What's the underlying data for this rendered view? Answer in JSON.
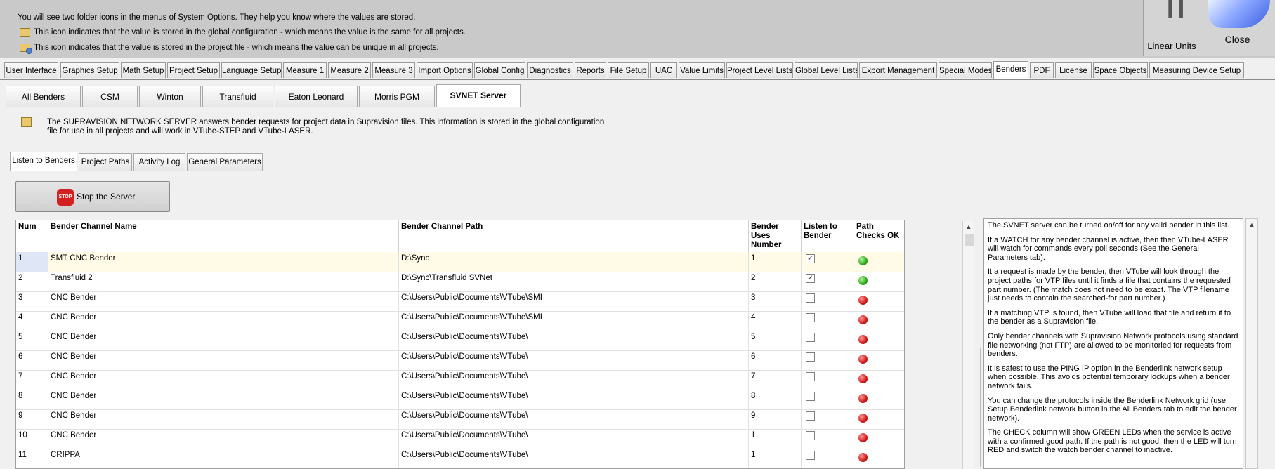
{
  "info": {
    "line1": "You will see two folder icons in the menus of System Options.  They help you know where the values are stored.",
    "line2": "This icon indicates that the value is stored in the global configuration - which means the value is the same for all projects.",
    "line3": "This icon indicates that the value is stored in the project file - which means the value can be unique in all projects."
  },
  "units": {
    "label": "Linear Units",
    "glyph": "┃┃"
  },
  "close": {
    "label": "Close"
  },
  "main_tabs": [
    "User Interface",
    "Graphics Setup",
    "Math Setup",
    "Project Setup",
    "Language Setup",
    "Measure 1",
    "Measure 2",
    "Measure 3",
    "Import Options",
    "Global Config",
    "Diagnostics",
    "Reports",
    "File Setup",
    "UAC",
    "Value Limits",
    "Project Level Lists",
    "Global Level Lists",
    "Export Management",
    "Special Modes",
    "Benders",
    "PDF",
    "License",
    "Space Objects",
    "Measuring Device Setup"
  ],
  "bender_tabs": [
    "All Benders",
    "CSM",
    "Winton",
    "Transfluid",
    "Eaton Leonard",
    "Morris PGM",
    "SVNET Server"
  ],
  "description": "The SUPRAVISION NETWORK SERVER answers bender requests for project data in Supravision files.  This information is stored in the global configuration file for use in all projects and will work in VTube-STEP and VTube-LASER.",
  "sub_tabs": [
    "Listen to Benders",
    "Project Paths",
    "Activity Log",
    "General Parameters"
  ],
  "stop_button": {
    "label": "Stop the Server",
    "icon_text": "STOP"
  },
  "grid": {
    "headers": [
      "Num",
      "Bender Channel Name",
      "Bender Channel Path",
      "Bender Uses Number",
      "Listen to Bender",
      "Path Checks OK"
    ],
    "rows": [
      {
        "num": "1",
        "name": "SMT CNC Bender",
        "path": "D:\\Sync",
        "uses": "1",
        "listen": true,
        "ok": "green"
      },
      {
        "num": "2",
        "name": "Transfluid 2",
        "path": "D:\\Sync\\Transfluid SVNet",
        "uses": "2",
        "listen": true,
        "ok": "green"
      },
      {
        "num": "3",
        "name": "CNC Bender",
        "path": "C:\\Users\\Public\\Documents\\VTube\\SMI",
        "uses": "3",
        "listen": false,
        "ok": "red"
      },
      {
        "num": "4",
        "name": "CNC Bender",
        "path": "C:\\Users\\Public\\Documents\\VTube\\SMI",
        "uses": "4",
        "listen": false,
        "ok": "red"
      },
      {
        "num": "5",
        "name": "CNC Bender",
        "path": "C:\\Users\\Public\\Documents\\VTube\\",
        "uses": "5",
        "listen": false,
        "ok": "red"
      },
      {
        "num": "6",
        "name": "CNC Bender",
        "path": "C:\\Users\\Public\\Documents\\VTube\\",
        "uses": "6",
        "listen": false,
        "ok": "red"
      },
      {
        "num": "7",
        "name": "CNC Bender",
        "path": "C:\\Users\\Public\\Documents\\VTube\\",
        "uses": "7",
        "listen": false,
        "ok": "red"
      },
      {
        "num": "8",
        "name": "CNC Bender",
        "path": "C:\\Users\\Public\\Documents\\VTube\\",
        "uses": "8",
        "listen": false,
        "ok": "red"
      },
      {
        "num": "9",
        "name": "CNC Bender",
        "path": "C:\\Users\\Public\\Documents\\VTube\\",
        "uses": "9",
        "listen": false,
        "ok": "red"
      },
      {
        "num": "10",
        "name": "CNC Bender",
        "path": "C:\\Users\\Public\\Documents\\VTube\\",
        "uses": "1",
        "listen": false,
        "ok": "red"
      },
      {
        "num": "11",
        "name": "CRIPPA",
        "path": "C:\\Users\\Public\\Documents\\VTube\\",
        "uses": "1",
        "listen": false,
        "ok": "red"
      }
    ]
  },
  "notes": [
    "The SVNET server can be turned on/off for any valid bender in this list.",
    "If a WATCH for any bender channel is active, then then VTube-LASER will watch for commands every poll seconds (See the General Parameters tab).",
    "It a request is made by the bender, then VTube will look through the project paths for VTP files until it finds a file that contains the requested part number.  (The match does not need to be exact.  The VTP filename just needs to contain the searched-for part number.)",
    "If a matching VTP is found, then VTube will load that file and return it to the bender as a Supravision file.",
    "Only bender channels with Supravision Network protocols using standard file networking (not FTP) are allowed to be monitoried for requests from benders.",
    "It is safest to use the PING IP option in the Benderlink network setup when possible.  This avoids potential temporary lockups when a bender network fails.",
    "You can change the protocols inside the Benderlink Network grid (use Setup Benderlink network button in the All Benders tab to edit the bender network).",
    "The CHECK column will show GREEN LEDs when the service is active with a confirmed good path.  If the path is not good, then the LED will turn RED and switch the watch bender channel to inactive."
  ],
  "colors": {
    "accent_active_tab": "#ffffff",
    "led_green": "#2ea81a",
    "led_red": "#d01818",
    "stop_red": "#d32020"
  }
}
